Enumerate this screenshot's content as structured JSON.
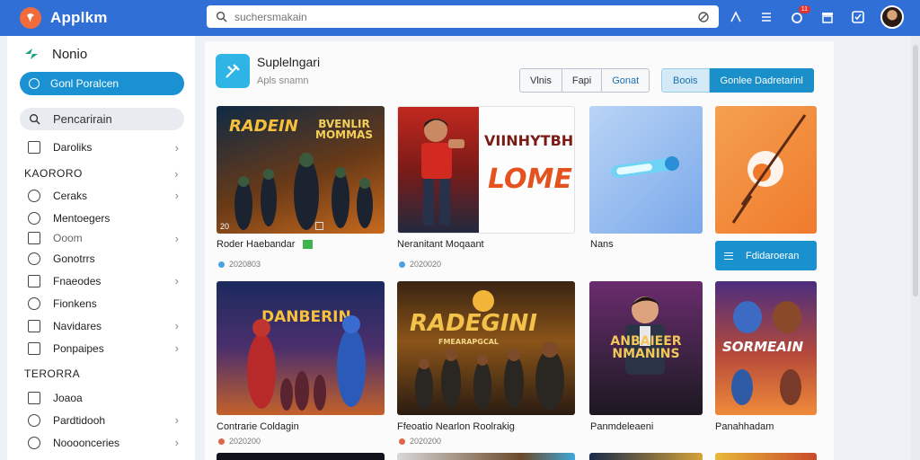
{
  "app": {
    "title": "Applkm"
  },
  "search": {
    "placeholder": "suchersmakain"
  },
  "topbar": {
    "notification_badge": "11"
  },
  "sidebar": {
    "title": "Nonio",
    "active_item": "Gonl Poralcen",
    "search_label": "Pencarirain",
    "first_item": "Daroliks",
    "section1": "KAORORO",
    "items1": [
      "Ceraks",
      "Mentoegers",
      "Ooom",
      "Gonotrrs",
      "Fnaeodes",
      "Fionkens",
      "Navidares",
      "Ponpaipes"
    ],
    "section2": "TERORRA",
    "items2": [
      "Joaoa",
      "Pardtidooh",
      "Noooonceries"
    ]
  },
  "main": {
    "app_name": "Suplelngari",
    "app_sub": "Apls snamn",
    "seg_buttons": [
      "Vlnis",
      "Fapi",
      "Gonat"
    ],
    "seg2_buttons": [
      "Boois",
      "Gonlee Dadretarinl"
    ],
    "cta_label": "Fdidaroeran",
    "cards": [
      {
        "label": "Roder Haebandar",
        "meta": "2020803",
        "art": "RADEIN",
        "art2": "BVENLIR MOMMAS",
        "num": "20"
      },
      {
        "label": "Neranitant Moqaant",
        "meta": "2020020",
        "art": "VIINHYTBH",
        "art2": "LOME"
      },
      {
        "label": "Nans"
      },
      {
        "label": ""
      },
      {
        "label": "Contrarie Coldagin",
        "meta": "2020200",
        "art": "DANBERIN"
      },
      {
        "label": "Ffeoatio Nearlon Roolrakig",
        "meta": "2020200",
        "art": "RADEGINI",
        "art2": "FMEARAPGCAL"
      },
      {
        "label": "Panmdeleaeni",
        "art": "ANBAIEER NMANINS"
      },
      {
        "label": "Panahhadam",
        "art": "SORMEAIN"
      }
    ]
  },
  "colors": {
    "topbar": "#2f6fd6",
    "accent": "#1991d3",
    "logo": "#f26b3a"
  }
}
